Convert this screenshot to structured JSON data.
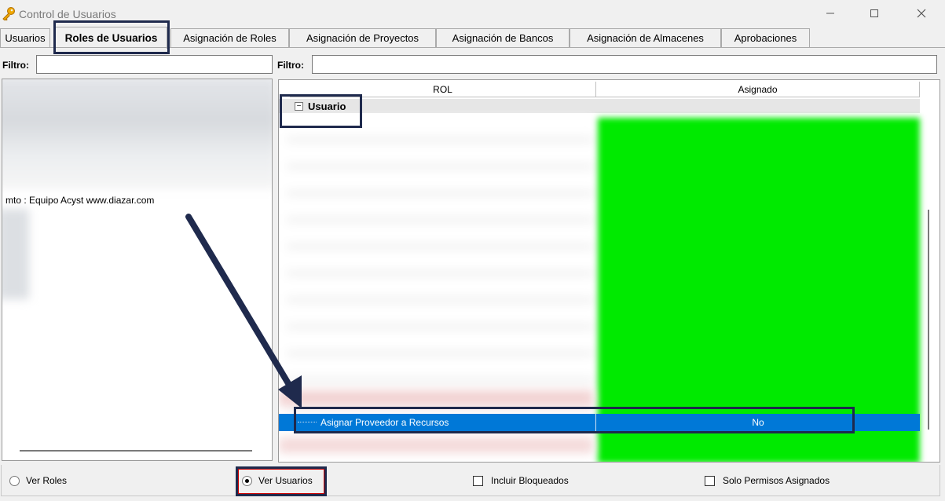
{
  "window": {
    "title": "Control de Usuarios",
    "icon": "key-icon",
    "controls": [
      "minimize-icon",
      "maximize-icon",
      "close-icon"
    ]
  },
  "tabs": [
    {
      "label": "Usuarios",
      "active": false
    },
    {
      "label": "Roles de Usuarios",
      "active": true
    },
    {
      "label": "Asignación de Roles",
      "active": false
    },
    {
      "label": "Asignación de Proyectos",
      "active": false
    },
    {
      "label": "Asignación de Bancos",
      "active": false
    },
    {
      "label": "Asignación de Almacenes",
      "active": false
    },
    {
      "label": "Aprobaciones",
      "active": false
    }
  ],
  "left": {
    "filter_label": "Filtro:",
    "filter_value": "",
    "visible_item": "mto : Equipo Acyst www.diazar.com"
  },
  "right": {
    "filter_label": "Filtro:",
    "filter_value": "",
    "columns": [
      "ROL",
      "Asignado"
    ],
    "group": {
      "label": "Usuario",
      "toggle": "−"
    },
    "selected_row": {
      "rol": "Asignar Proveedor a Recursos",
      "asignado": "No"
    }
  },
  "options": {
    "ver_roles": {
      "label": "Ver Roles",
      "checked": false
    },
    "ver_usuarios": {
      "label": "Ver Usuarios",
      "checked": true
    },
    "incluir_bloqueados": {
      "label": "Incluir Bloqueados",
      "checked": false
    },
    "solo_permisos": {
      "label": "Solo Permisos Asignados",
      "checked": false
    }
  },
  "colors": {
    "selection": "#0078d7",
    "assigned_green": "#00ea00",
    "annotation": "#1f2a4d"
  }
}
